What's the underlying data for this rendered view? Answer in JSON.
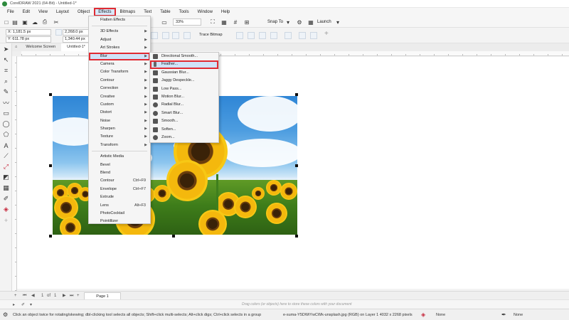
{
  "window": {
    "title": "CorelDRAW 2021 (64-Bit) - Untitled-1*"
  },
  "menubar": [
    "File",
    "Edit",
    "View",
    "Layout",
    "Object",
    "Effects",
    "Bitmaps",
    "Text",
    "Table",
    "Tools",
    "Window",
    "Help"
  ],
  "active_menu": "Effects",
  "standard_toolbar": {
    "zoom": "33%",
    "snap_to": "Snap To",
    "launch": "Launch"
  },
  "property_bar": {
    "x": "X: 1,181.5 px",
    "y": "Y: 611.78 px",
    "width": "2,268.0 px",
    "height": "1,340.44 px",
    "trace_bitmap": "Trace Bitmap"
  },
  "doc_tabs": [
    "Welcome Screen",
    "Untitled-1*"
  ],
  "effects_menu": [
    {
      "label": "Flatten Effects",
      "submenu": false
    },
    {
      "sep": true
    },
    {
      "label": "3D Effects",
      "submenu": true
    },
    {
      "label": "Adjust",
      "submenu": true
    },
    {
      "label": "Art Strokes",
      "submenu": true
    },
    {
      "label": "Blur",
      "submenu": true,
      "selected": true
    },
    {
      "label": "Camera",
      "submenu": true
    },
    {
      "label": "Color Transform",
      "submenu": true
    },
    {
      "label": "Contour",
      "submenu": true
    },
    {
      "label": "Correction",
      "submenu": true
    },
    {
      "label": "Creative",
      "submenu": true
    },
    {
      "label": "Custom",
      "submenu": true
    },
    {
      "label": "Distort",
      "submenu": true
    },
    {
      "label": "Noise",
      "submenu": true
    },
    {
      "label": "Sharpen",
      "submenu": true
    },
    {
      "label": "Texture",
      "submenu": true
    },
    {
      "label": "Transform",
      "submenu": true
    },
    {
      "sep": true
    },
    {
      "label": "Artistic Media",
      "shortcut": ""
    },
    {
      "label": "Bevel",
      "shortcut": ""
    },
    {
      "label": "Blend",
      "shortcut": ""
    },
    {
      "label": "Contour",
      "shortcut": "Ctrl+F9"
    },
    {
      "label": "Envelope",
      "shortcut": "Ctrl+F7"
    },
    {
      "label": "Extrude",
      "shortcut": ""
    },
    {
      "label": "Lens",
      "shortcut": "Alt+F3"
    },
    {
      "label": "PhotoCocktail",
      "shortcut": ""
    },
    {
      "label": "Pointillizer",
      "shortcut": ""
    }
  ],
  "blur_submenu": [
    {
      "label": "Directional Smooth...",
      "icon": "directional-smooth-icon"
    },
    {
      "label": "Feather...",
      "icon": "feather-icon",
      "selected": true
    },
    {
      "label": "Gaussian Blur...",
      "icon": "gaussian-blur-icon"
    },
    {
      "label": "Jaggy Despeckle...",
      "icon": "jaggy-despeckle-icon"
    },
    {
      "label": "Low Pass...",
      "icon": "low-pass-icon"
    },
    {
      "label": "Motion Blur...",
      "icon": "motion-blur-icon"
    },
    {
      "label": "Radial Blur...",
      "icon": "radial-blur-icon"
    },
    {
      "label": "Smart Blur...",
      "icon": "smart-blur-icon"
    },
    {
      "label": "Smooth...",
      "icon": "smooth-icon"
    },
    {
      "label": "Soften...",
      "icon": "soften-icon"
    },
    {
      "label": "Zoom...",
      "icon": "zoom-icon"
    }
  ],
  "page_bar": {
    "page_count": "1",
    "of_label": "of",
    "page_tab": "Page 1"
  },
  "palette_hint": "Drag colors (or objects) here to store these colors with your document",
  "status": {
    "hint": "Click an object twice for rotating/skewing; dbl-clicking tool selects all objects; Shift+click multi-selects; Alt+click digs; Ctrl+click selects in a group",
    "object_info": "e-suma-Y5DWiYwCWk-unsplash.jpg (RGB) on Layer 1 4032 x 2268 pixels",
    "fill": "None",
    "outline": "None"
  },
  "colors": {
    "highlight_red": "#e02b33",
    "menu_hover": "#cfe3f8"
  }
}
